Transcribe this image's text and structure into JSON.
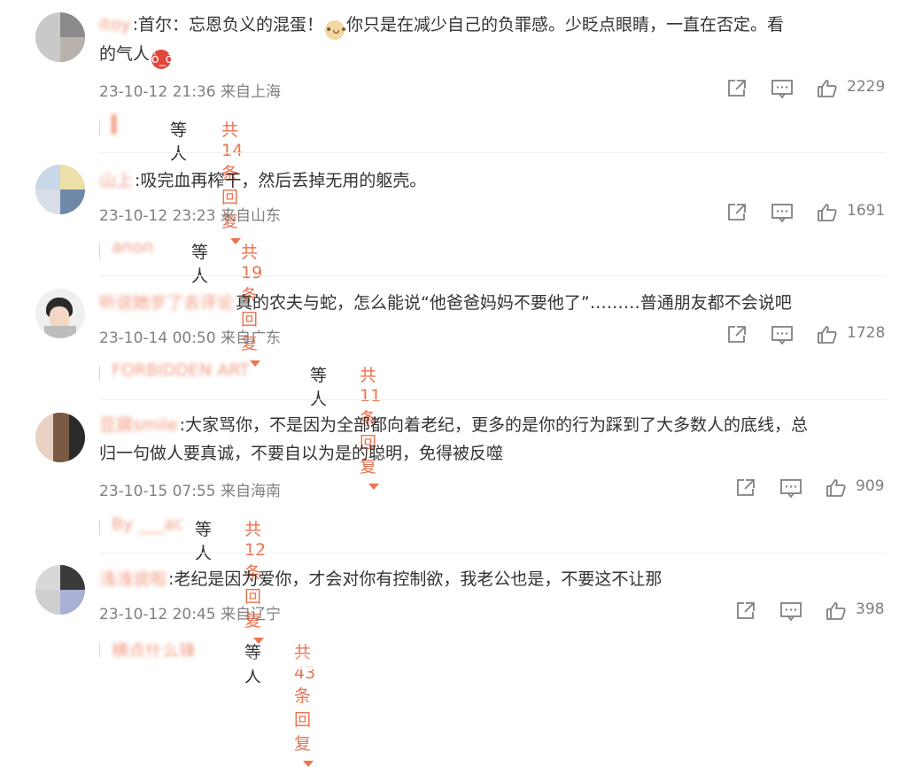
{
  "comments": [
    {
      "username": "itoy",
      "text_before_emoji": ":首尔：忘恩负义的混蛋！",
      "text_after_emoji": "你只是在减少自己的负罪感。少眨点眼睛，一直在否定。看",
      "line2_before_emoji": "的气人",
      "meta": "23-10-12 21:36 来自上海",
      "likes": "2229",
      "reply_names": "▍",
      "reply_deng": "等人",
      "reply_total": "共14条回复"
    },
    {
      "username": "山上",
      "text": ":吸完血再榨干，然后丢掉无用的躯壳。",
      "meta": "23-10-12 23:23 来自山东",
      "likes": "1691",
      "reply_names": "anon",
      "reply_deng": "等人",
      "reply_total": "共19条回复"
    },
    {
      "username": "听说她岁了去评论",
      "text": "真的农夫与蛇，怎么能说“他爸爸妈妈不要他了”………普通朋友都不会说吧",
      "meta": "23-10-14 00:50 来自广东",
      "likes": "1728",
      "reply_names": "FORBIDDEN ART",
      "reply_deng": "等人",
      "reply_total": "共11条回复"
    },
    {
      "username": "豆腐smile",
      "text": ":大家骂你，不是因为全部都向着老纪，更多的是你的行为踩到了大多数人的底线，总",
      "line2": "归一句做人要真诚，不要自以为是的聪明，免得被反噬",
      "meta": "23-10-15 07:55 来自海南",
      "likes": "909",
      "reply_names": "By ___ac",
      "reply_deng": "等人",
      "reply_total": "共12条回复"
    },
    {
      "username": "浅浅说啦",
      "text": ":老纪是因为爱你，才会对你有控制欲，我老公也是，不要这不让那",
      "meta": "23-10-12 20:45 来自辽宁",
      "likes": "398",
      "reply_names": "横点什么锋",
      "reply_deng": "等人",
      "reply_total": "共43条回复"
    }
  ],
  "colors": {
    "accent": "#eb7350",
    "meta": "#7f7f7f",
    "text": "#333333"
  },
  "icons": {
    "share": "share-icon",
    "comment": "comment-icon",
    "like": "thumb-up-icon",
    "angry": "angry-face-emoji",
    "cat": "cat-face-emoji"
  }
}
